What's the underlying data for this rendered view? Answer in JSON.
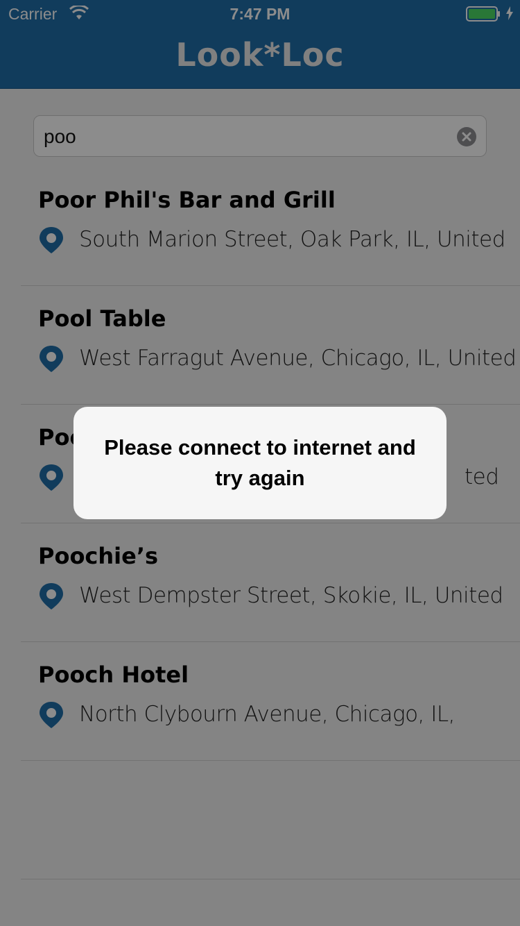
{
  "status_bar": {
    "carrier": "Carrier",
    "time": "7:47 PM",
    "battery_color": "#4cd964"
  },
  "header": {
    "title": "Look*Loc",
    "background_color": "#1f6da8"
  },
  "search": {
    "value": "poo",
    "clear_icon": "clear-icon"
  },
  "results": [
    {
      "name": "Poor Phil's Bar and Grill",
      "address": "South Marion Street, Oak Park, IL, United"
    },
    {
      "name": "Pool Table",
      "address": "West Farragut Avenue, Chicago, IL, United"
    },
    {
      "name": "Poochie’s",
      "address": "West Dempster Street, Skokie, IL, United"
    },
    {
      "name": "Pooch Hotel",
      "address": "North Clybourn Avenue, Chicago, IL,"
    }
  ],
  "partially_hidden_result": {
    "name_visible": "Poo",
    "address_visible": "ted"
  },
  "toast": {
    "message": "Please connect to internet and try again"
  },
  "pin_color": "#1f6da8"
}
